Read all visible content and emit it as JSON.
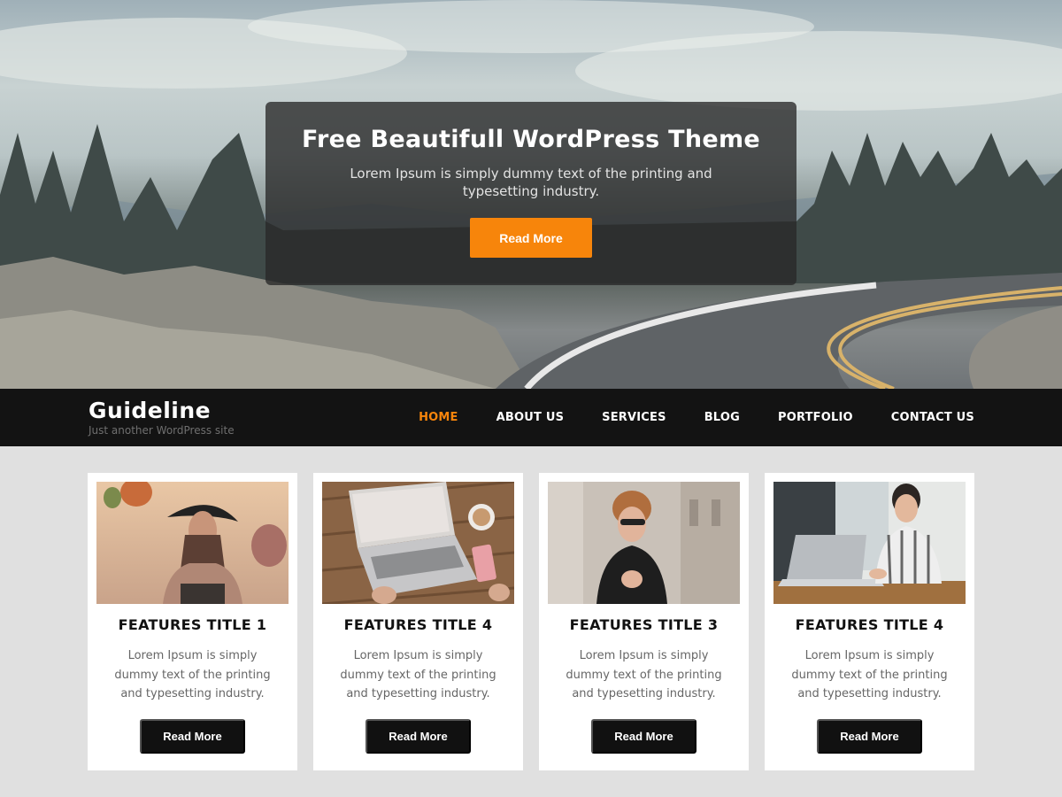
{
  "hero": {
    "title": "Free Beautifull WordPress Theme",
    "subtitle": "Lorem Ipsum is simply dummy text of the printing and typesetting industry.",
    "button_label": "Read More",
    "image": "mountain-road-landscape"
  },
  "header": {
    "site_title": "Guideline",
    "tagline": "Just another WordPress site"
  },
  "nav": {
    "items": [
      {
        "label": "HOME",
        "active": true
      },
      {
        "label": "ABOUT US",
        "active": false
      },
      {
        "label": "SERVICES",
        "active": false
      },
      {
        "label": "BLOG",
        "active": false
      },
      {
        "label": "PORTFOLIO",
        "active": false
      },
      {
        "label": "CONTACT US",
        "active": false
      }
    ]
  },
  "features": [
    {
      "title": "FEATURES TITLE 1",
      "text": "Lorem Ipsum is simply dummy text of the printing and typesetting industry.",
      "button_label": "Read More",
      "image": "woman-hat-balloons"
    },
    {
      "title": "FEATURES TITLE 4",
      "text": "Lorem Ipsum is simply dummy text of the printing and typesetting industry.",
      "button_label": "Read More",
      "image": "laptop-coffee-desk"
    },
    {
      "title": "FEATURES TITLE 3",
      "text": "Lorem Ipsum is simply dummy text of the printing and typesetting industry.",
      "button_label": "Read More",
      "image": "woman-sunglasses-city"
    },
    {
      "title": "FEATURES TITLE 4",
      "text": "Lorem Ipsum is simply dummy text of the printing and typesetting industry.",
      "button_label": "Read More",
      "image": "woman-laptop-cafe"
    }
  ],
  "colors": {
    "accent": "#f7850b",
    "navbar_bg": "#131313",
    "page_bg": "#e0e0e0",
    "button_dark": "#111111"
  }
}
